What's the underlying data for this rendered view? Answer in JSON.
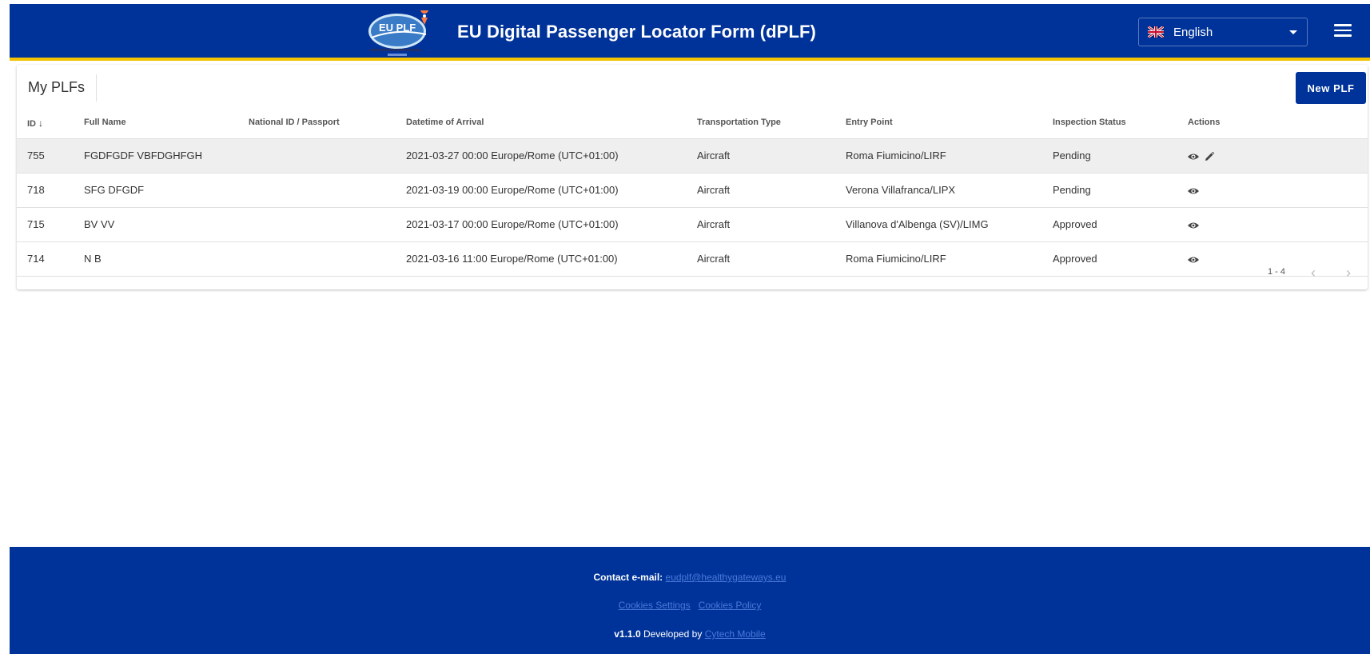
{
  "header": {
    "title": "EU Digital Passenger Locator Form (dPLF)",
    "logo_text": "EU PLF",
    "language": "English"
  },
  "page": {
    "title": "My PLFs",
    "new_button": "New PLF"
  },
  "table": {
    "columns": {
      "id": "ID",
      "full_name": "Full Name",
      "national_id": "National ID / Passport",
      "arrival": "Datetime of Arrival",
      "transport": "Transportation Type",
      "entry_point": "Entry Point",
      "status": "Inspection Status",
      "actions": "Actions"
    },
    "rows": [
      {
        "id": "755",
        "full_name": "FGDFGDF VBFDGHFGH",
        "national_id": "",
        "arrival": "2021-03-27 00:00 Europe/Rome (UTC+01:00)",
        "transport": "Aircraft",
        "entry_point": "Roma Fiumicino/LIRF",
        "status": "Pending"
      },
      {
        "id": "718",
        "full_name": "SFG DFGDF",
        "national_id": "",
        "arrival": "2021-03-19 00:00 Europe/Rome (UTC+01:00)",
        "transport": "Aircraft",
        "entry_point": "Verona Villafranca/LIPX",
        "status": "Pending"
      },
      {
        "id": "715",
        "full_name": "BV VV",
        "national_id": "",
        "arrival": "2021-03-17 00:00 Europe/Rome (UTC+01:00)",
        "transport": "Aircraft",
        "entry_point": "Villanova d'Albenga (SV)/LIMG",
        "status": "Approved"
      },
      {
        "id": "714",
        "full_name": "N B",
        "national_id": "",
        "arrival": "2021-03-16 11:00 Europe/Rome (UTC+01:00)",
        "transport": "Aircraft",
        "entry_point": "Roma Fiumicino/LIRF",
        "status": "Approved"
      }
    ],
    "pagination": "1 - 4"
  },
  "footer": {
    "contact_label": "Contact e-mail:",
    "contact_email": "eudplf@healthygateways.eu",
    "cookies_settings": "Cookies Settings",
    "cookies_policy": "Cookies Policy",
    "version": "v1.1.0",
    "developed_by": "Developed by",
    "developer": "Cytech Mobile"
  },
  "colors": {
    "brand_blue": "#003399",
    "accent_yellow": "#f2c300",
    "link": "#4a78d8"
  },
  "icons": [
    "menu-icon",
    "eye-icon",
    "pencil-icon",
    "arrow-down-icon",
    "chevron-left-icon",
    "chevron-right-icon",
    "uk-flag-icon",
    "caret-down-icon"
  ]
}
